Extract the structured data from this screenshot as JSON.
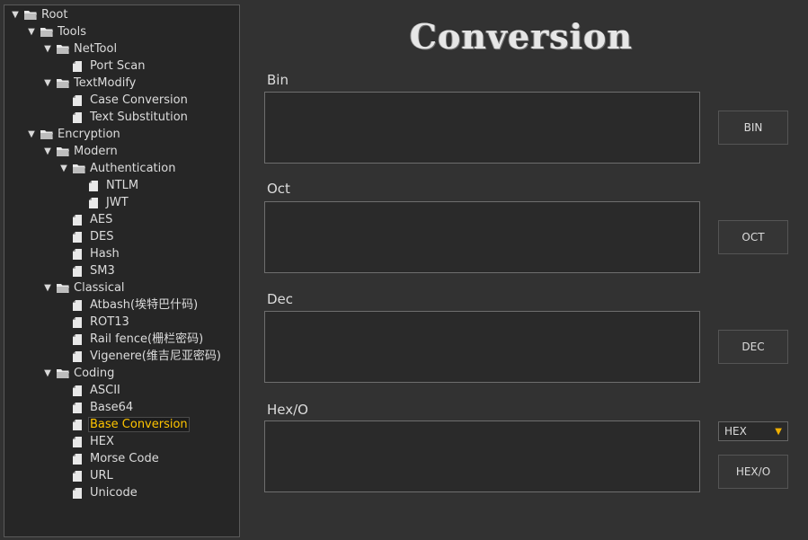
{
  "tree": {
    "items": [
      {
        "label": "Root",
        "level": 0,
        "type": "folder",
        "expanded": true
      },
      {
        "label": "Tools",
        "level": 1,
        "type": "folder",
        "expanded": true
      },
      {
        "label": "NetTool",
        "level": 2,
        "type": "folder",
        "expanded": true
      },
      {
        "label": "Port Scan",
        "level": 3,
        "type": "file"
      },
      {
        "label": "TextModify",
        "level": 2,
        "type": "folder",
        "expanded": true
      },
      {
        "label": "Case Conversion",
        "level": 3,
        "type": "file"
      },
      {
        "label": "Text Substitution",
        "level": 3,
        "type": "file"
      },
      {
        "label": "Encryption",
        "level": 1,
        "type": "folder",
        "expanded": true
      },
      {
        "label": "Modern",
        "level": 2,
        "type": "folder",
        "expanded": true
      },
      {
        "label": "Authentication",
        "level": 3,
        "type": "folder",
        "expanded": true
      },
      {
        "label": "NTLM",
        "level": 4,
        "type": "file"
      },
      {
        "label": "JWT",
        "level": 4,
        "type": "file"
      },
      {
        "label": "AES",
        "level": 3,
        "type": "file"
      },
      {
        "label": "DES",
        "level": 3,
        "type": "file"
      },
      {
        "label": "Hash",
        "level": 3,
        "type": "file"
      },
      {
        "label": "SM3",
        "level": 3,
        "type": "file"
      },
      {
        "label": "Classical",
        "level": 2,
        "type": "folder",
        "expanded": true
      },
      {
        "label": "Atbash(埃特巴什码)",
        "level": 3,
        "type": "file"
      },
      {
        "label": "ROT13",
        "level": 3,
        "type": "file"
      },
      {
        "label": "Rail fence(栅栏密码)",
        "level": 3,
        "type": "file"
      },
      {
        "label": "Vigenere(维吉尼亚密码)",
        "level": 3,
        "type": "file"
      },
      {
        "label": "Coding",
        "level": 2,
        "type": "folder",
        "expanded": true
      },
      {
        "label": "ASCII",
        "level": 3,
        "type": "file"
      },
      {
        "label": "Base64",
        "level": 3,
        "type": "file"
      },
      {
        "label": "Base Conversion",
        "level": 3,
        "type": "file",
        "selected": true
      },
      {
        "label": "HEX",
        "level": 3,
        "type": "file"
      },
      {
        "label": "Morse Code",
        "level": 3,
        "type": "file"
      },
      {
        "label": "URL",
        "level": 3,
        "type": "file"
      },
      {
        "label": "Unicode",
        "level": 3,
        "type": "file"
      }
    ]
  },
  "main": {
    "title": "Conversion",
    "bin": {
      "label": "Bin",
      "value": "",
      "button": "BIN"
    },
    "oct": {
      "label": "Oct",
      "value": "",
      "button": "OCT"
    },
    "dec": {
      "label": "Dec",
      "value": "",
      "button": "DEC"
    },
    "hex": {
      "label": "Hex/O",
      "value": "",
      "button": "HEX/O",
      "select_value": "HEX"
    }
  },
  "colors": {
    "background": "#323232",
    "tree_background": "#262626",
    "selected_text": "#ffc400",
    "dropdown_arrow": "#f0b000"
  }
}
